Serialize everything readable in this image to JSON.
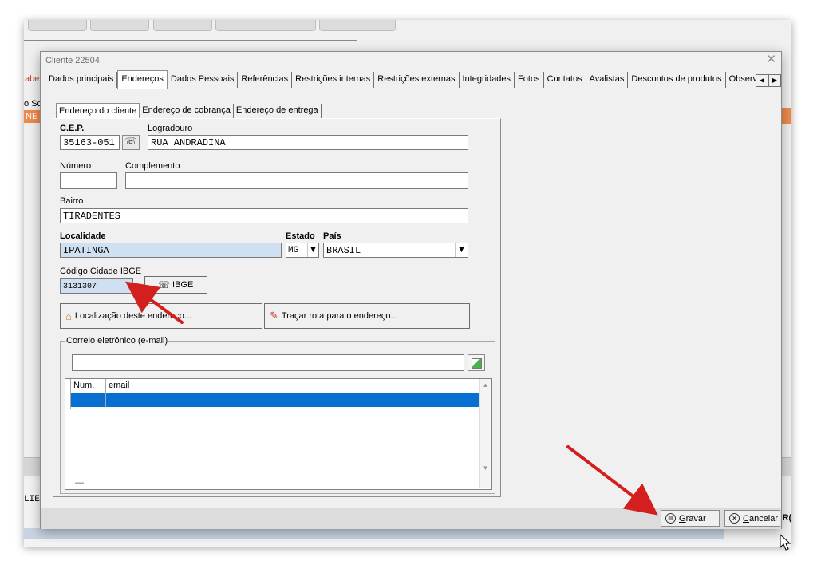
{
  "background": {
    "left_fragments": [
      "abe",
      "o Sc",
      "NE"
    ],
    "left_bottom_text": "LIE",
    "right_fragment": "'R("
  },
  "dialog": {
    "title": "Cliente 22504",
    "tabs": [
      "Dados principais",
      "Endereços",
      "Dados Pessoais",
      "Referências",
      "Restrições internas",
      "Restrições externas",
      "Integridades",
      "Fotos",
      "Contatos",
      "Avalistas",
      "Descontos de produtos",
      "Observaçõ"
    ],
    "active_tab": "Endereços",
    "inner_tabs": [
      "Endereço do cliente",
      "Endereço de cobrança",
      "Endereço de entrega"
    ],
    "active_inner_tab": "Endereço do cliente"
  },
  "address": {
    "cep_label": "C.E.P.",
    "cep_value": "35163-051",
    "logradouro_label": "Logradouro",
    "logradouro_value": "RUA ANDRADINA",
    "numero_label": "Número",
    "numero_value": "",
    "complemento_label": "Complemento",
    "complemento_value": "",
    "bairro_label": "Bairro",
    "bairro_value": "TIRADENTES",
    "localidade_label": "Localidade",
    "localidade_value": "IPATINGA",
    "estado_label": "Estado",
    "estado_value": "MG",
    "pais_label": "País",
    "pais_value": "BRASIL",
    "ibge_label": "Código Cidade IBGE",
    "ibge_value": "3131307",
    "ibge_button": "IBGE",
    "localizacao_button": "Localização deste endereço...",
    "rota_button": "Traçar rota para o endereço..."
  },
  "email": {
    "group_label": "Correio eletrônico (e-mail)",
    "input_value": "",
    "columns": [
      "Num.",
      "email"
    ],
    "footer_mark": "—"
  },
  "footer": {
    "gravar_prefix": "G",
    "gravar_rest": "ravar",
    "cancelar_prefix": "C",
    "cancelar_rest": "ancelar"
  },
  "colors": {
    "selection": "#0a6fd3",
    "field_blue": "#cfe0f0",
    "accent_orange": "#f08a4b",
    "arrow_red": "#d41f1f"
  }
}
